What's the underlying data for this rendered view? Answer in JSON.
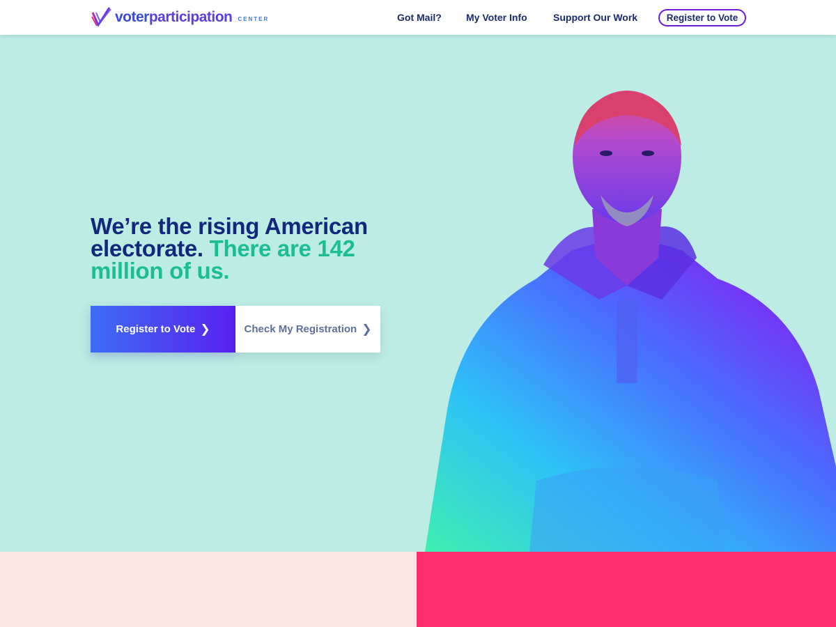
{
  "brand": {
    "name_part1": "voter",
    "name_part2": "participation",
    "subtitle": "CENTER",
    "icon": "checkmark-logo-icon"
  },
  "nav": {
    "items": [
      {
        "label": "Got Mail?"
      },
      {
        "label": "My Voter Info"
      },
      {
        "label": "Support Our Work"
      }
    ],
    "cta_label": "Register to Vote"
  },
  "hero": {
    "headline_main": "We’re the rising American electorate.",
    "headline_accent": "There are 142 million of us.",
    "primary_button": "Register to Vote",
    "secondary_button": "Check My Registration",
    "chevron_icon": "chevron-right-icon"
  },
  "colors": {
    "hero_bg": "#bcece4",
    "headline": "#13287a",
    "accent": "#1dbd94",
    "button_gradient_start": "#3c6df5",
    "button_gradient_end": "#5a1ff0",
    "nav_outline": "#6b1fd6",
    "block_pink_light": "#fde6e4",
    "block_pink": "#ff2d6b"
  }
}
